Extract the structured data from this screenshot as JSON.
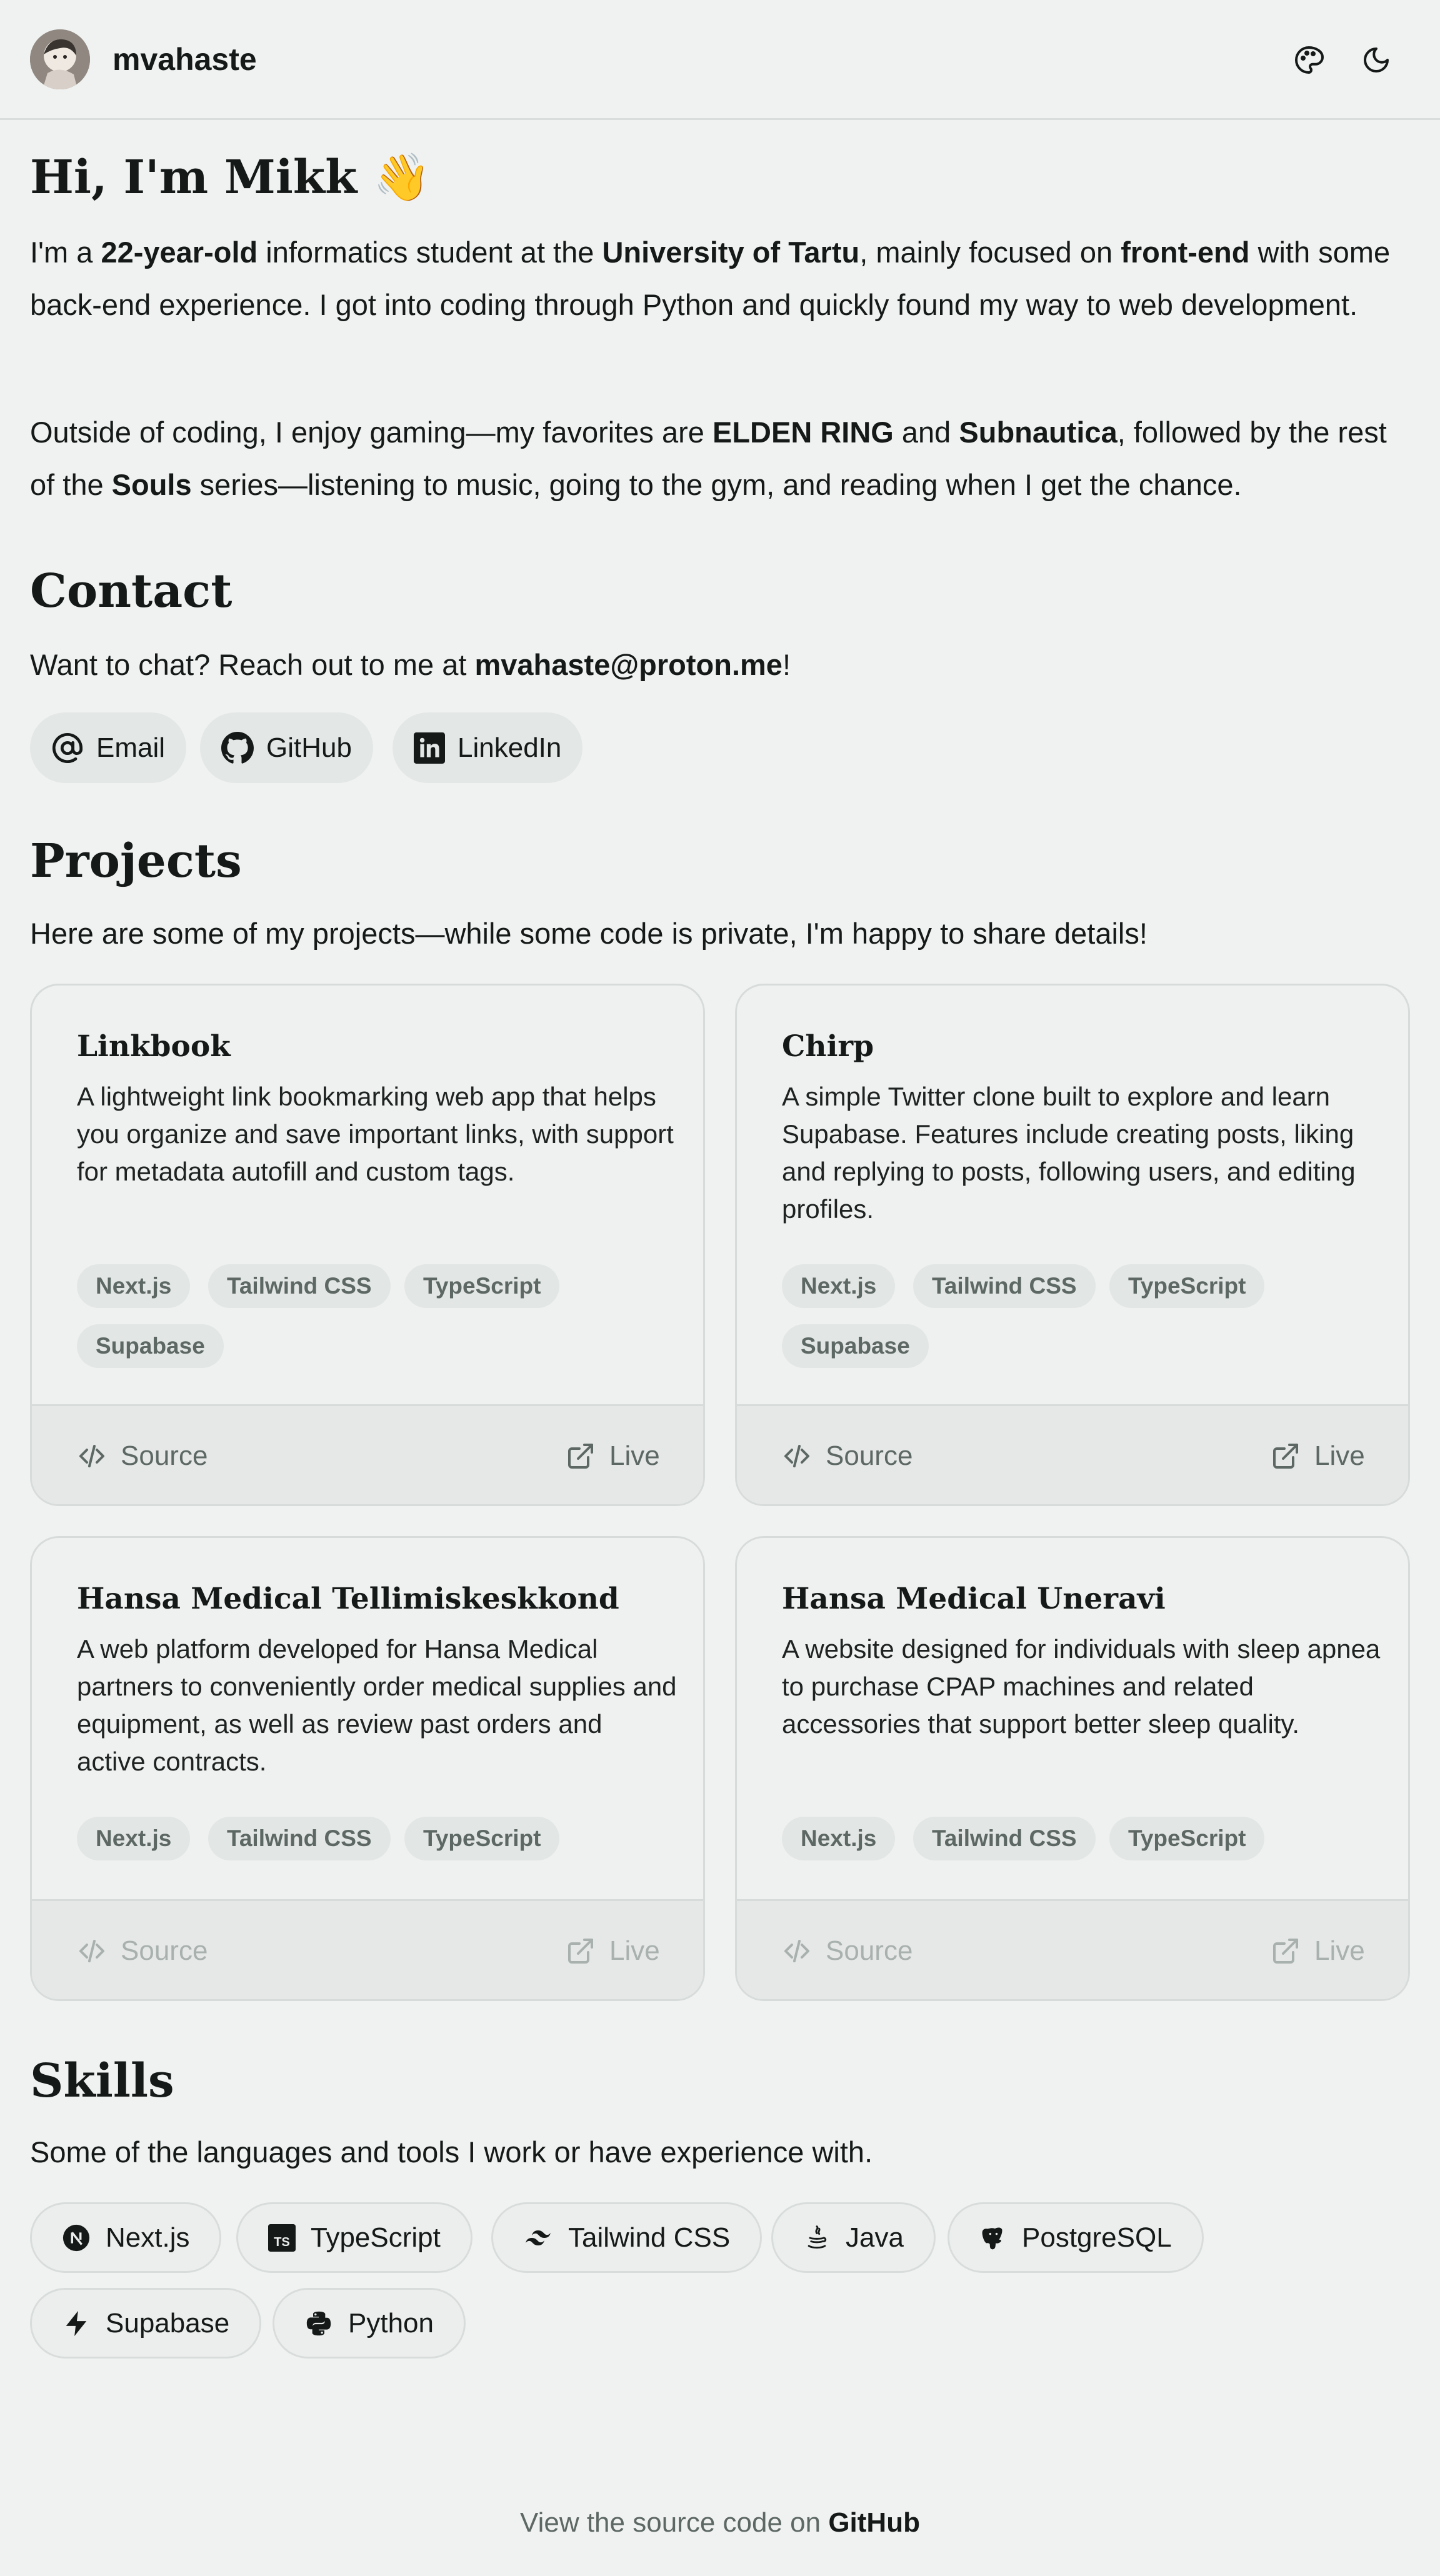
{
  "header": {
    "brand": "mvahaste",
    "theme_icon": "palette-icon",
    "mode_icon": "moon-icon"
  },
  "intro": {
    "title": "Hi, I'm Mikk 👋",
    "p1_a": "I'm a ",
    "p1_b": "22-year-old",
    "p1_c": " informatics student at the ",
    "p1_d": "University of Tartu",
    "p1_e": ", mainly focused on ",
    "p1_f": "front-end",
    "p1_g": " with some back-end experience. I got into coding through Python and quickly found my way to web development.",
    "p2_a": "Outside of coding, I enjoy gaming—my favorites are ",
    "p2_b": "ELDEN RING",
    "p2_c": " and ",
    "p2_d": "Subnautica",
    "p2_e": ", followed by the rest of the ",
    "p2_f": "Souls",
    "p2_g": " series—listening to music, going to the gym, and reading when I get the chance."
  },
  "contact": {
    "title": "Contact",
    "text_a": "Want to chat? Reach out to me at ",
    "email": "mvahaste@proton.me",
    "text_b": "!",
    "buttons": [
      {
        "label": "Email",
        "icon": "at-sign-icon"
      },
      {
        "label": "GitHub",
        "icon": "github-icon"
      },
      {
        "label": "LinkedIn",
        "icon": "linkedin-icon"
      }
    ]
  },
  "projects": {
    "title": "Projects",
    "subtitle": "Here are some of my projects—while some code is private, I'm happy to share details!",
    "source_label": "Source",
    "live_label": "Live",
    "items": [
      {
        "title": "Linkbook",
        "description": "A lightweight link bookmarking web app that helps you organize and save important links, with support for metadata autofill and custom tags.",
        "tags": [
          "Next.js",
          "Tailwind CSS",
          "TypeScript",
          "Supabase"
        ],
        "links_enabled": true
      },
      {
        "title": "Chirp",
        "description": "A simple Twitter clone built to explore and learn Supabase. Features include creating posts, liking and replying to posts, following users, and editing profiles.",
        "tags": [
          "Next.js",
          "Tailwind CSS",
          "TypeScript",
          "Supabase"
        ],
        "links_enabled": true
      },
      {
        "title": "Hansa Medical Tellimiskeskkond",
        "description": "A web platform developed for Hansa Medical partners to conveniently order medical supplies and equipment, as well as review past orders and active contracts.",
        "tags": [
          "Next.js",
          "Tailwind CSS",
          "TypeScript"
        ],
        "links_enabled": false
      },
      {
        "title": "Hansa Medical Uneravi",
        "description": "A website designed for individuals with sleep apnea to purchase CPAP machines and related accessories that support better sleep quality.",
        "tags": [
          "Next.js",
          "Tailwind CSS",
          "TypeScript"
        ],
        "links_enabled": false
      }
    ]
  },
  "skills": {
    "title": "Skills",
    "subtitle": "Some of the languages and tools I work or have experience with.",
    "items": [
      {
        "label": "Next.js",
        "icon": "nextjs-icon"
      },
      {
        "label": "TypeScript",
        "icon": "typescript-icon"
      },
      {
        "label": "Tailwind CSS",
        "icon": "tailwind-icon"
      },
      {
        "label": "Java",
        "icon": "java-icon"
      },
      {
        "label": "PostgreSQL",
        "icon": "postgresql-icon"
      },
      {
        "label": "Supabase",
        "icon": "supabase-icon"
      },
      {
        "label": "Python",
        "icon": "python-icon"
      }
    ]
  },
  "footer": {
    "text": "View the source code on ",
    "link": "GitHub"
  }
}
